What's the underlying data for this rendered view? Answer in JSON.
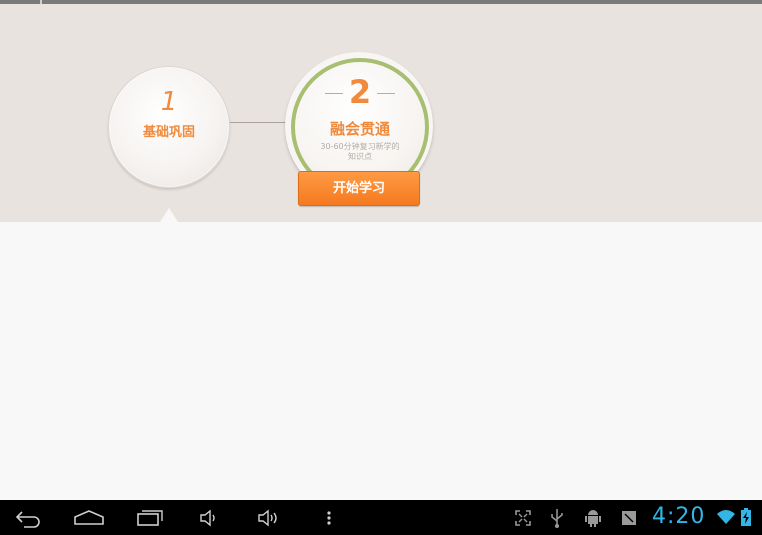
{
  "steps": [
    {
      "number": "1",
      "title": "基础巩固"
    },
    {
      "number": "2",
      "title": "融会贯通",
      "subtitle_line1": "30-60分钟复习新学的",
      "subtitle_line2": "知识点"
    }
  ],
  "start_button": {
    "label": "开始学习"
  },
  "status_bar": {
    "time": "4:20"
  },
  "colors": {
    "accent": "#f08a3c",
    "ring": "#a8bf72",
    "clock": "#33b5e5",
    "button": "#f47a1f"
  },
  "icons": {
    "nav": [
      "back-icon",
      "home-icon",
      "recent-apps-icon",
      "volume-down-icon",
      "volume-up-icon",
      "menu-icon"
    ],
    "status": [
      "screenshot-expand-icon",
      "usb-icon",
      "android-debug-icon",
      "sd-card-icon",
      "wifi-icon",
      "battery-icon"
    ]
  }
}
